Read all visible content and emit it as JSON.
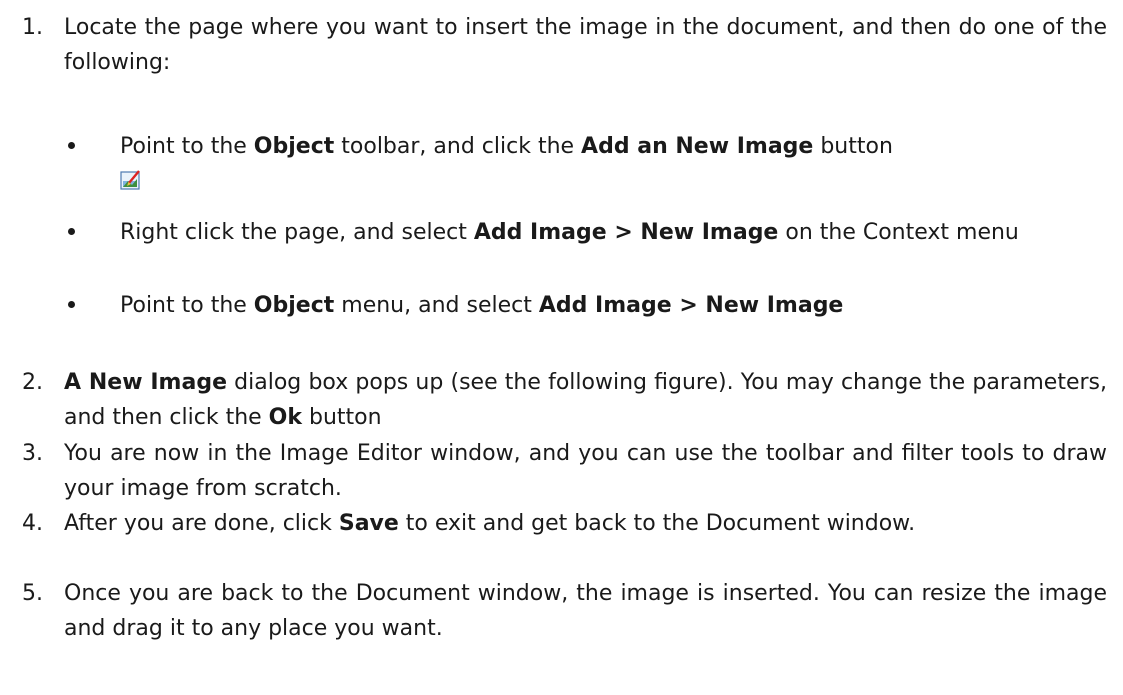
{
  "steps": [
    {
      "num": "1.",
      "t0": "Locate the page where you want to insert the image in the document, and then do one of the following:"
    },
    {
      "num": "2.",
      "t0": "A New Image",
      "t1": " dialog box pops up (see the following figure). You may change the parameters, and then click the ",
      "t2": "Ok",
      "t3": " button"
    },
    {
      "num": "3.",
      "t0": "You are now in the Image Editor window, and you can use the toolbar and filter tools to draw your image from scratch."
    },
    {
      "num": "4.",
      "t0": "After you are done, click ",
      "t1": "Save",
      "t2": " to exit and get back to the Document window."
    },
    {
      "num": "5.",
      "t0": "Once you are back to the Document window, the image is inserted. You can resize the image and drag it to any place you want."
    }
  ],
  "bullets": [
    {
      "t0": "Point to the ",
      "t1": "Object",
      "t2": " toolbar, and click the ",
      "t3": "Add an New Image",
      "t4": " button"
    },
    {
      "t0": "Right click the page, and select ",
      "t1": "Add Image > New Image",
      "t2": " on the Context menu"
    },
    {
      "t0": "Point to the ",
      "t1": "Object",
      "t2": " menu, and select ",
      "t3": "Add Image > New Image"
    }
  ],
  "icons": {
    "new_image_button": "add-new-image-icon"
  }
}
